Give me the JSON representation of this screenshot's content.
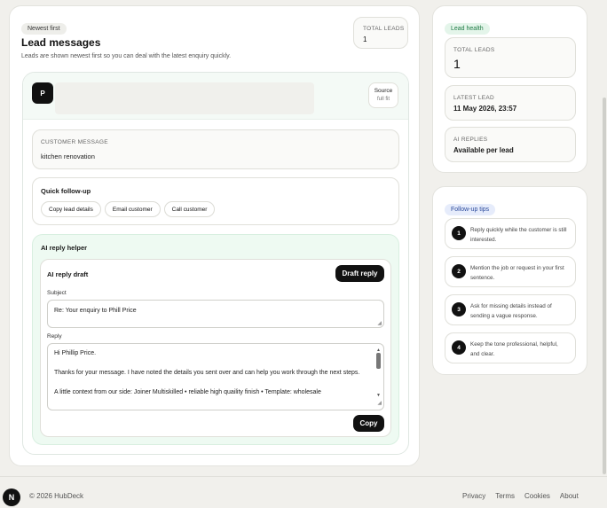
{
  "header": {
    "sort_badge": "Newest first",
    "title": "Lead messages",
    "subtitle": "Leads are shown newest first so you can deal with the latest enquiry quickly.",
    "total_leads_label": "TOTAL LEADS",
    "total_leads_value": "1"
  },
  "lead": {
    "avatar_initial": "P",
    "source_label": "Source",
    "source_value": "full fit",
    "customer_message_label": "CUSTOMER MESSAGE",
    "customer_message": "kitchen renovation",
    "quick_followup_title": "Quick follow-up",
    "actions": [
      "Copy lead details",
      "Email customer",
      "Call customer"
    ]
  },
  "ai": {
    "section_title": "AI reply helper",
    "draft_title": "AI reply draft",
    "draft_button": "Draft reply",
    "subject_label": "Subject",
    "subject_value": "Re: Your enquiry to Phill Price",
    "reply_label": "Reply",
    "reply_lines": [
      "Hi Phillip Price.",
      "Thanks for your message. I have noted the details you sent over and can help you work through the next steps.",
      "A little context from our side: Joiner Multiskilled • reliable high quaility finish • Template: wholesale"
    ],
    "copy_button": "Copy"
  },
  "sidebar": {
    "health_badge": "Lead health",
    "stats": [
      {
        "label": "TOTAL LEADS",
        "value": "1"
      },
      {
        "label": "LATEST LEAD",
        "value": "11 May 2026, 23:57"
      },
      {
        "label": "AI REPLIES",
        "value": "Available per lead"
      }
    ],
    "tips_badge": "Follow-up tips",
    "tips": [
      {
        "num": "1",
        "text": "Reply quickly while the customer is still interested."
      },
      {
        "num": "2",
        "text": "Mention the job or request in your first sentence."
      },
      {
        "num": "3",
        "text": "Ask for missing details instead of sending a vague response."
      },
      {
        "num": "4",
        "text": "Keep the tone professional, helpful, and clear."
      }
    ]
  },
  "footer": {
    "badge": "N",
    "copyright": "© 2026 HubDeck",
    "links": [
      "Privacy",
      "Terms",
      "Cookies",
      "About"
    ]
  }
}
